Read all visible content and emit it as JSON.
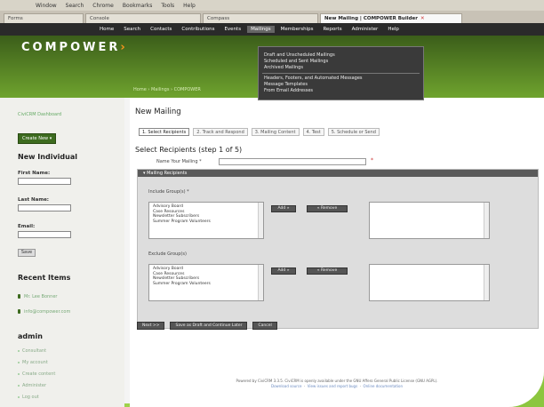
{
  "browser": {
    "menu": [
      "Window",
      "Search",
      "Chrome",
      "Bookmarks",
      "Tools",
      "Help"
    ],
    "tabs": [
      {
        "label": "Forms",
        "active": false
      },
      {
        "label": "Console",
        "active": false
      },
      {
        "label": "Compass",
        "active": false
      },
      {
        "label": "New Mailing | COMPOWER Builder",
        "active": true
      }
    ]
  },
  "topnav": {
    "items": [
      "Home",
      "Search",
      "Contacts",
      "Contributions",
      "Events",
      "Mailings",
      "Memberships",
      "Reports",
      "Administer",
      "Help"
    ],
    "active_index": 5
  },
  "header": {
    "logo_part1": "COMP",
    "logo_part2": "OWER",
    "logo_arrow": "›",
    "breadcrumb": "Home › Mailings › COMPOWER"
  },
  "mailings_menu": {
    "items": [
      "Draft and Unscheduled Mailings",
      "Scheduled and Sent Mailings",
      "Archived Mailings",
      "Headers, Footers, and Automated Messages",
      "Message Templates",
      "From Email Addresses"
    ]
  },
  "sidebar": {
    "dashboard_link": "CiviCRM Dashboard",
    "create_new_button": "Create New ▾",
    "new_individual_title": "New Individual",
    "first_name_label": "First Name:",
    "last_name_label": "Last Name:",
    "email_label": "Email:",
    "save_button": "Save",
    "recent_items_title": "Recent Items",
    "recent_items": [
      "Mr. Lee Bonner",
      "info@compower.com"
    ],
    "admin_title": "admin",
    "admin_items": [
      "Consultant",
      "My account",
      "Create content",
      "Administer",
      "Log out"
    ]
  },
  "main": {
    "title": "New Mailing",
    "steps": [
      {
        "label": "1. Select Recipients",
        "active": true
      },
      {
        "label": "2. Track and Respond",
        "active": false
      },
      {
        "label": "3. Mailing Content",
        "active": false
      },
      {
        "label": "4. Test",
        "active": false
      },
      {
        "label": "5. Schedule or Send",
        "active": false
      }
    ],
    "step_title": "Select Recipients (step 1 of 5)",
    "name_label": "Name Your Mailing *",
    "name_value": "",
    "required_mark": "*",
    "panel_header": "▾ Mailing Recipients",
    "include_label": "Include Group(s) *",
    "exclude_label": "Exclude Group(s)",
    "groups": [
      "Advisory Board",
      "Case Resources",
      "Newsletter Subscribers",
      "Summer Program Volunteers"
    ],
    "add_button": "Add »",
    "remove_button": "« Remove",
    "actions": [
      "Next >>",
      "Save as Draft and Continue Later",
      "Cancel"
    ]
  },
  "footer": {
    "line1": "Powered by CiviCRM 3.3.5. CiviCRM is openly available under the GNU Affero General Public License (GNU AGPL).",
    "line2_links": [
      "Download source",
      "View issues and report bugs",
      "Online documentation"
    ]
  }
}
